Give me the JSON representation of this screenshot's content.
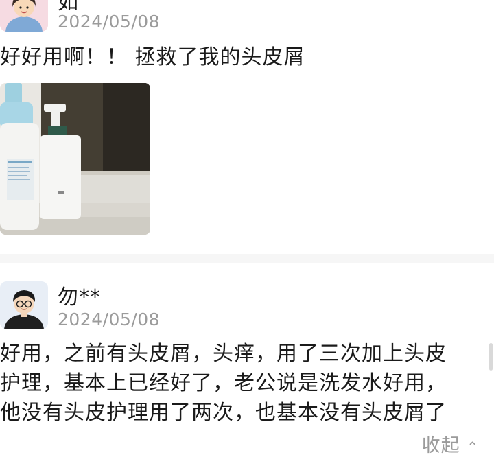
{
  "reviews": [
    {
      "username": "如",
      "date": "2024/05/08",
      "text": [
        "好好用啊！！ 拯救了我的头皮屑"
      ],
      "has_photo": true
    },
    {
      "username": "勿**",
      "date": "2024/05/08",
      "text": [
        "好用，之前有头皮屑，头痒，用了三次加上头皮",
        "护理，基本上已经好了，老公说是洗发水好用，",
        "他没有头皮护理用了两次，也基本没有头皮屑了"
      ]
    }
  ],
  "collapse_label": "收起",
  "icons": {
    "collapse": "chevron-up-icon"
  },
  "colors": {
    "date": "#9b9b9b",
    "text": "#1a1a1a",
    "divider": "#f6f6f6"
  }
}
